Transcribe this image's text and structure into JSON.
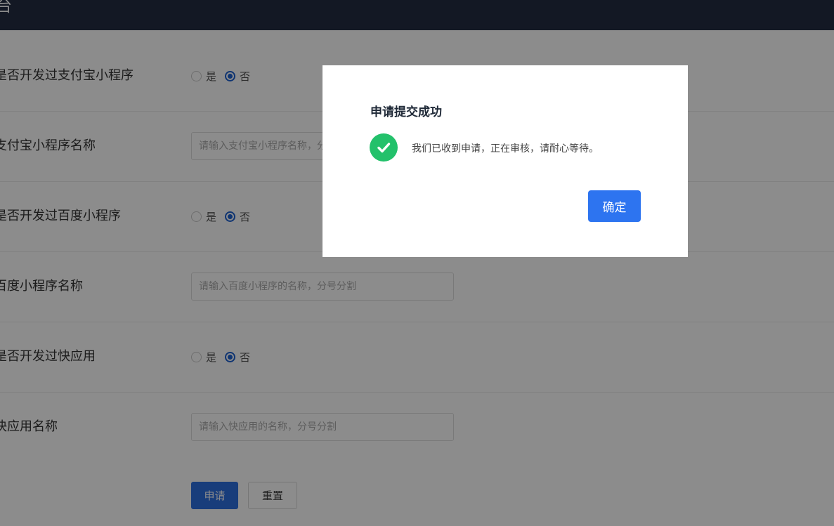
{
  "header": {
    "title": "台"
  },
  "form": {
    "rows": [
      {
        "label": "是否开发过支付宝小程序",
        "options": [
          "是",
          "否"
        ],
        "selected": "否"
      },
      {
        "label": "支付宝小程序名称",
        "placeholder": "请输入支付宝小程序名称，分号分割"
      },
      {
        "label": "是否开发过百度小程序",
        "options": [
          "是",
          "否"
        ],
        "selected": "否"
      },
      {
        "label": "百度小程序名称",
        "placeholder": "请输入百度小程序的名称，分号分割"
      },
      {
        "label": "是否开发过快应用",
        "options": [
          "是",
          "否"
        ],
        "selected": "否"
      },
      {
        "label": "快应用名称",
        "placeholder": "请输入快应用的名称，分号分割"
      }
    ],
    "submit_label": "申请",
    "reset_label": "重置"
  },
  "modal": {
    "title": "申请提交成功",
    "message": "我们已收到申请，正在审核，请耐心等待。",
    "confirm_label": "确定",
    "icon": "check-circle-icon"
  },
  "colors": {
    "header_bg": "#232d42",
    "primary": "#2d74f0",
    "success": "#23c16b"
  }
}
